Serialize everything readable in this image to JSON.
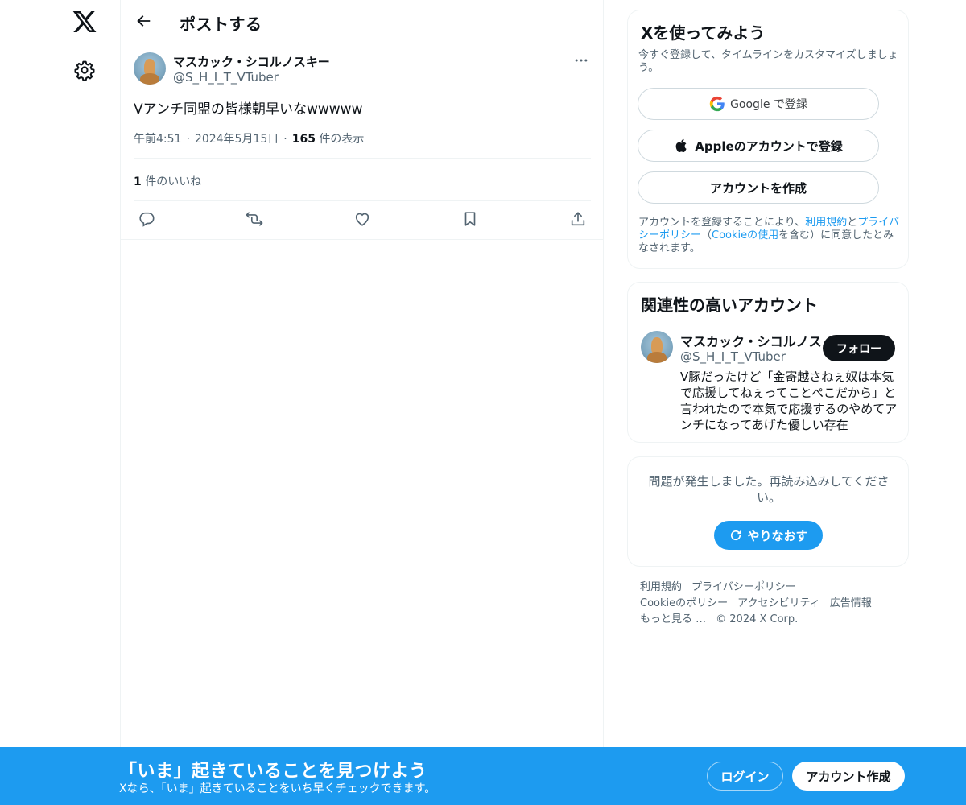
{
  "nav": {
    "logo_icon": "x-logo-icon",
    "settings_icon": "gear-icon"
  },
  "header": {
    "back_icon": "arrow-left-icon",
    "title": "ポストする"
  },
  "post": {
    "author_name": "マスカック・シコルノスキー",
    "author_handle": "@S_H_I_T_VTuber",
    "text": "Vアンチ同盟の皆様朝早いなwwwww",
    "time": "午前4:51",
    "date": "2024年5月15日",
    "view_count": "165",
    "view_label": "件の表示",
    "like_count": "1",
    "like_label": "件のいいね",
    "actions": [
      "reply-icon",
      "repost-icon",
      "like-icon",
      "bookmark-icon",
      "share-icon"
    ]
  },
  "signup": {
    "title": "Xを使ってみよう",
    "subtitle": "今すぐ登録して、タイムラインをカスタマイズしましょう。",
    "google_label": "Google で登録",
    "apple_label": "Appleのアカウントで登録",
    "create_label": "アカウントを作成",
    "legal_pre": "アカウントを登録することにより、",
    "legal_terms": "利用規約",
    "legal_and": "と",
    "legal_privacy": "プライバシーポリシー",
    "legal_mid": "（",
    "legal_cookie": "Cookieの使用",
    "legal_post": "を含む）に同意したとみなされます。"
  },
  "related": {
    "title": "関連性の高いアカウント",
    "name": "マスカック・シコルノス",
    "handle": "@S_H_I_T_VTuber",
    "follow_label": "フォロー",
    "bio": "V豚だったけど「金寄越さねぇ奴は本気で応援してねぇってことぺこだから」と言われたので本気で応援するのやめてアンチになってあげた優しい存在"
  },
  "error": {
    "message": "問題が発生しました。再読み込みしてください。",
    "retry_label": "やりなおす"
  },
  "footer": {
    "terms": "利用規約",
    "privacy": "プライバシーポリシー",
    "cookie": "Cookieのポリシー",
    "accessibility": "アクセシビリティ",
    "ads": "広告情報",
    "more": "もっと見る …",
    "copyright": "© 2024 X Corp."
  },
  "banner": {
    "title": "「いま」起きていることを見つけよう",
    "subtitle": "Xなら、「いま」起きていることをいち早くチェックできます。",
    "login_label": "ログイン",
    "signup_label": "アカウント作成"
  },
  "colors": {
    "accent": "#1d9bf0",
    "text": "#0f1419",
    "secondary_text": "#536471",
    "border": "#eff3f4"
  }
}
